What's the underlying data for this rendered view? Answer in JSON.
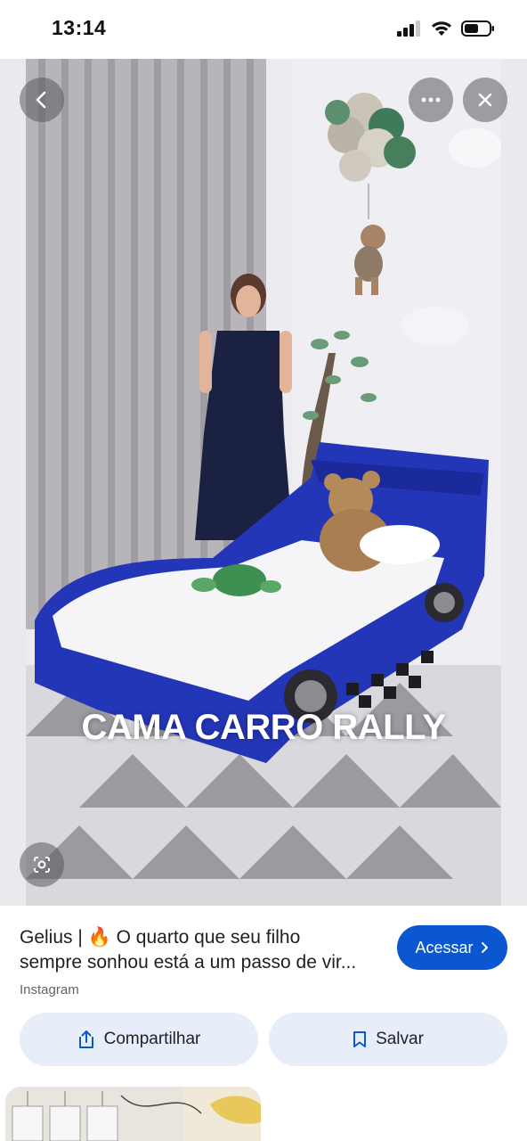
{
  "status_bar": {
    "time": "13:14"
  },
  "viewer": {
    "overlay_text": "CAMA CARRO RALLY",
    "icons": {
      "back": "chevron-left-icon",
      "more": "more-horizontal-icon",
      "close": "close-icon",
      "lens": "lens-search-icon"
    }
  },
  "result": {
    "title_line1": "Gelius | 🔥 O quarto que seu filho",
    "title_line2": "sempre sonhou está a um passo de vir...",
    "source": "Instagram",
    "visit_label": "Acessar",
    "share_label": "Compartilhar",
    "save_label": "Salvar"
  },
  "colors": {
    "accent": "#0b57d0",
    "pill_bg": "#e8eef9",
    "bed_blue": "#2436b8"
  }
}
